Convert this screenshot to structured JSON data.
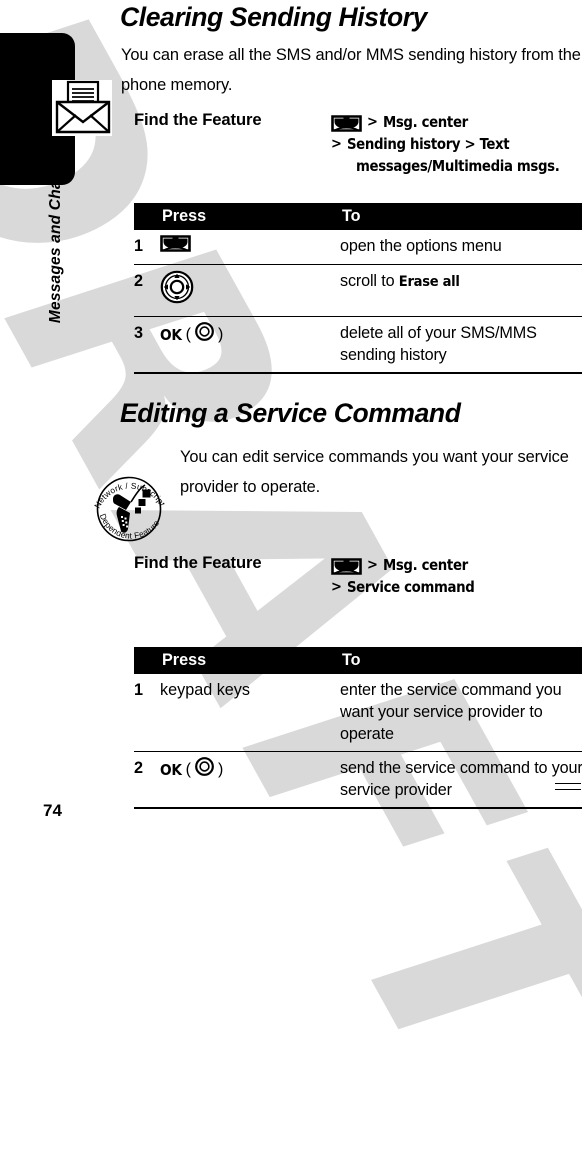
{
  "document": {
    "page_number": "74",
    "watermark_text": "DRAFT"
  },
  "sidebar": {
    "chapter_label": "Messages and Chat",
    "icon": "envelope-message-icon"
  },
  "sections": [
    {
      "title": "Clearing Sending History",
      "intro": "You can erase all the SMS and/or MMS sending history from the phone memory.",
      "find_the_feature": {
        "label": "Find the Feature",
        "menu_icon": "menu-key-icon",
        "path_lines": [
          {
            "separator": ">",
            "value": "Msg. center",
            "indent": false
          },
          {
            "separator": ">",
            "value": "Sending history > Text",
            "indent": true
          },
          {
            "separator": "",
            "value": "messages/Multimedia msgs.",
            "indent": true
          }
        ]
      },
      "table": {
        "headers": {
          "num": "",
          "press": "Press",
          "to": "To"
        },
        "rows": [
          {
            "num": "1",
            "press_kind": "menu-key-icon",
            "press_text": "",
            "to_prefix": "open the options menu",
            "to_bold": "",
            "to_suffix": ""
          },
          {
            "num": "2",
            "press_kind": "nav-key-icon",
            "press_text": "",
            "to_prefix": "scroll to ",
            "to_bold": "Erase all",
            "to_suffix": ""
          },
          {
            "num": "3",
            "press_kind": "ok-key-icon",
            "press_text": "OK",
            "to_prefix": "delete all of your SMS/MMS sending history",
            "to_bold": "",
            "to_suffix": ""
          }
        ]
      }
    },
    {
      "title": "Editing a Service Command",
      "intro": "You can edit service commands you want your service provider to operate.",
      "note_icon": "network-subscription-dependent-feature-icon",
      "note_icon_text_top": "Network / Subscription",
      "note_icon_text_bottom": "Dependent  Feature",
      "find_the_feature": {
        "label": "Find the Feature",
        "menu_icon": "menu-key-icon",
        "path_lines": [
          {
            "separator": ">",
            "value": "Msg. center",
            "indent": false
          },
          {
            "separator": ">",
            "value": "Service command",
            "indent": true
          }
        ]
      },
      "table": {
        "headers": {
          "num": "",
          "press": "Press",
          "to": "To"
        },
        "rows": [
          {
            "num": "1",
            "press_kind": "text",
            "press_text": "keypad keys",
            "to_prefix": "enter the service command you want your service provider to operate",
            "to_bold": "",
            "to_suffix": ""
          },
          {
            "num": "2",
            "press_kind": "ok-key-icon",
            "press_text": "OK",
            "to_prefix": "send the service command to your service provider",
            "to_bold": "",
            "to_suffix": ""
          }
        ]
      }
    }
  ],
  "colors": {
    "ink": "#000000",
    "paper": "#ffffff",
    "watermark": "#d9d9d9"
  }
}
